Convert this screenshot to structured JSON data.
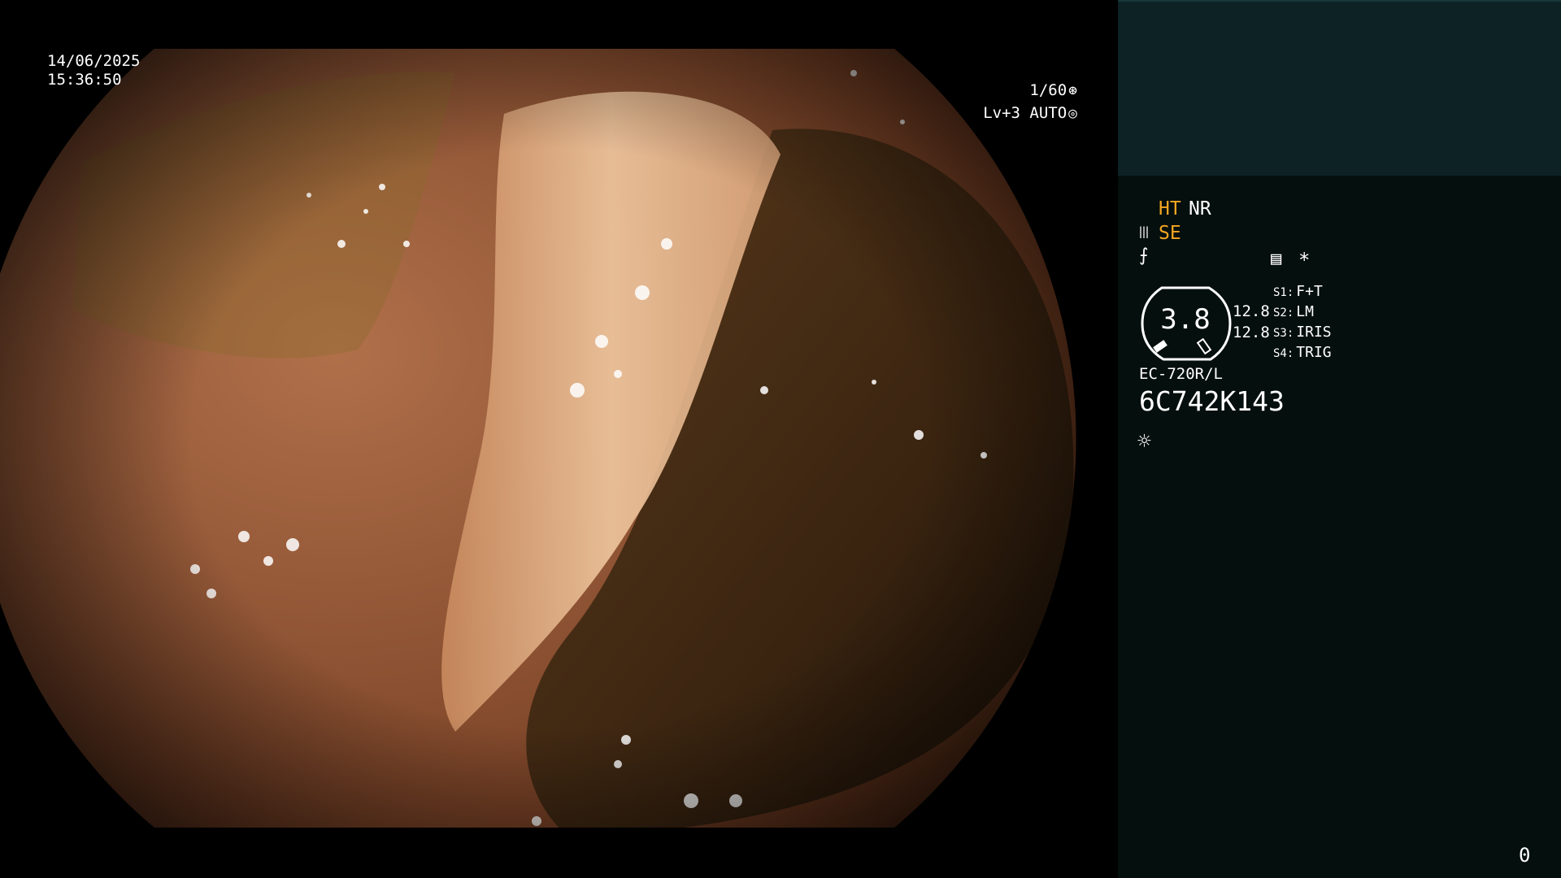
{
  "osd": {
    "date": "14/06/2025",
    "time": "15:36:50",
    "shutter": "1/60",
    "shutter_icon": "aperture-icon",
    "level": "Lv+3 AUTO",
    "auto_icon": "auto-iris-icon"
  },
  "panel": {
    "ht_label": "HT",
    "nr_label": "NR",
    "se_label": "SE",
    "se_icon": "structure-enhance-icon",
    "enhance_icon": "enhance-icon",
    "menu_icon": "menu-icon",
    "asterisk": "*",
    "gauge_value": "3.8",
    "gauge_readings": [
      "12.8",
      "12.8"
    ],
    "switches": [
      {
        "key": "S1:",
        "value": "F+T"
      },
      {
        "key": "S2:",
        "value": "LM"
      },
      {
        "key": "S3:",
        "value": "IRIS"
      },
      {
        "key": "S4:",
        "value": "TRIG"
      }
    ],
    "scope_model": "EC-720R/L",
    "serial": "6C742K143",
    "light_icon": "light-source-icon",
    "counter": "0"
  },
  "colors": {
    "accent_orange": "#f5a623",
    "panel_top": "#0d2224",
    "panel_body": "#050f0d"
  }
}
